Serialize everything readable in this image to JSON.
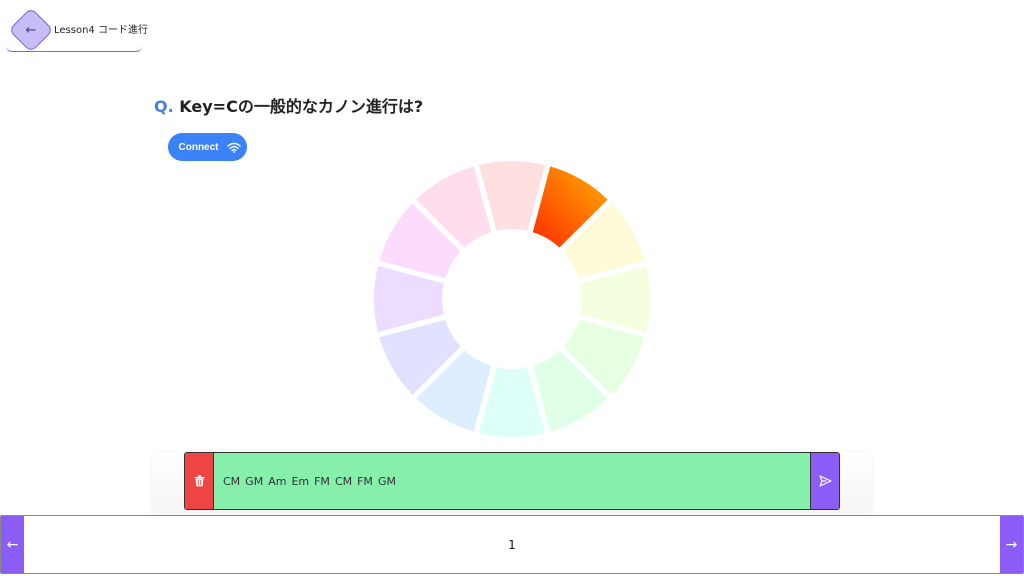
{
  "header": {
    "back_icon": "arrow-left-icon",
    "back_glyph": "←",
    "title": "Lesson4 コード進行"
  },
  "question": {
    "prefix": "Q.",
    "text": "Key=Cの一般的なカノン進行は?"
  },
  "connect": {
    "label": "Connect",
    "icon": "wifi-icon"
  },
  "wheel": {
    "segment_count": 12,
    "active_index": 1,
    "segment_colors": [
      "#ffe0e0",
      "#ff5500",
      "#fffbd8",
      "#f4ffe0",
      "#e6ffe0",
      "#dfffe8",
      "#dcfff8",
      "#ddeeff",
      "#e0e0ff",
      "#ecdcff",
      "#fbdcff",
      "#ffdcee"
    ],
    "active_gradient": [
      "#ff2a00",
      "#ffb000"
    ]
  },
  "progression": {
    "delete_icon": "trash-icon",
    "send_icon": "send-icon",
    "chords": [
      "CM",
      "GM",
      "Am",
      "Em",
      "FM",
      "CM",
      "FM",
      "GM"
    ],
    "colors": {
      "delete_bg": "#ef4444",
      "chord_bg": "#86efac",
      "send_bg": "#8b5cf6"
    }
  },
  "pager": {
    "prev_glyph": "←",
    "next_glyph": "→",
    "prev_icon": "arrow-left-icon",
    "next_icon": "arrow-right-icon",
    "page": "1"
  },
  "accent": "#8b5cf6",
  "primary": "#3b82f6"
}
